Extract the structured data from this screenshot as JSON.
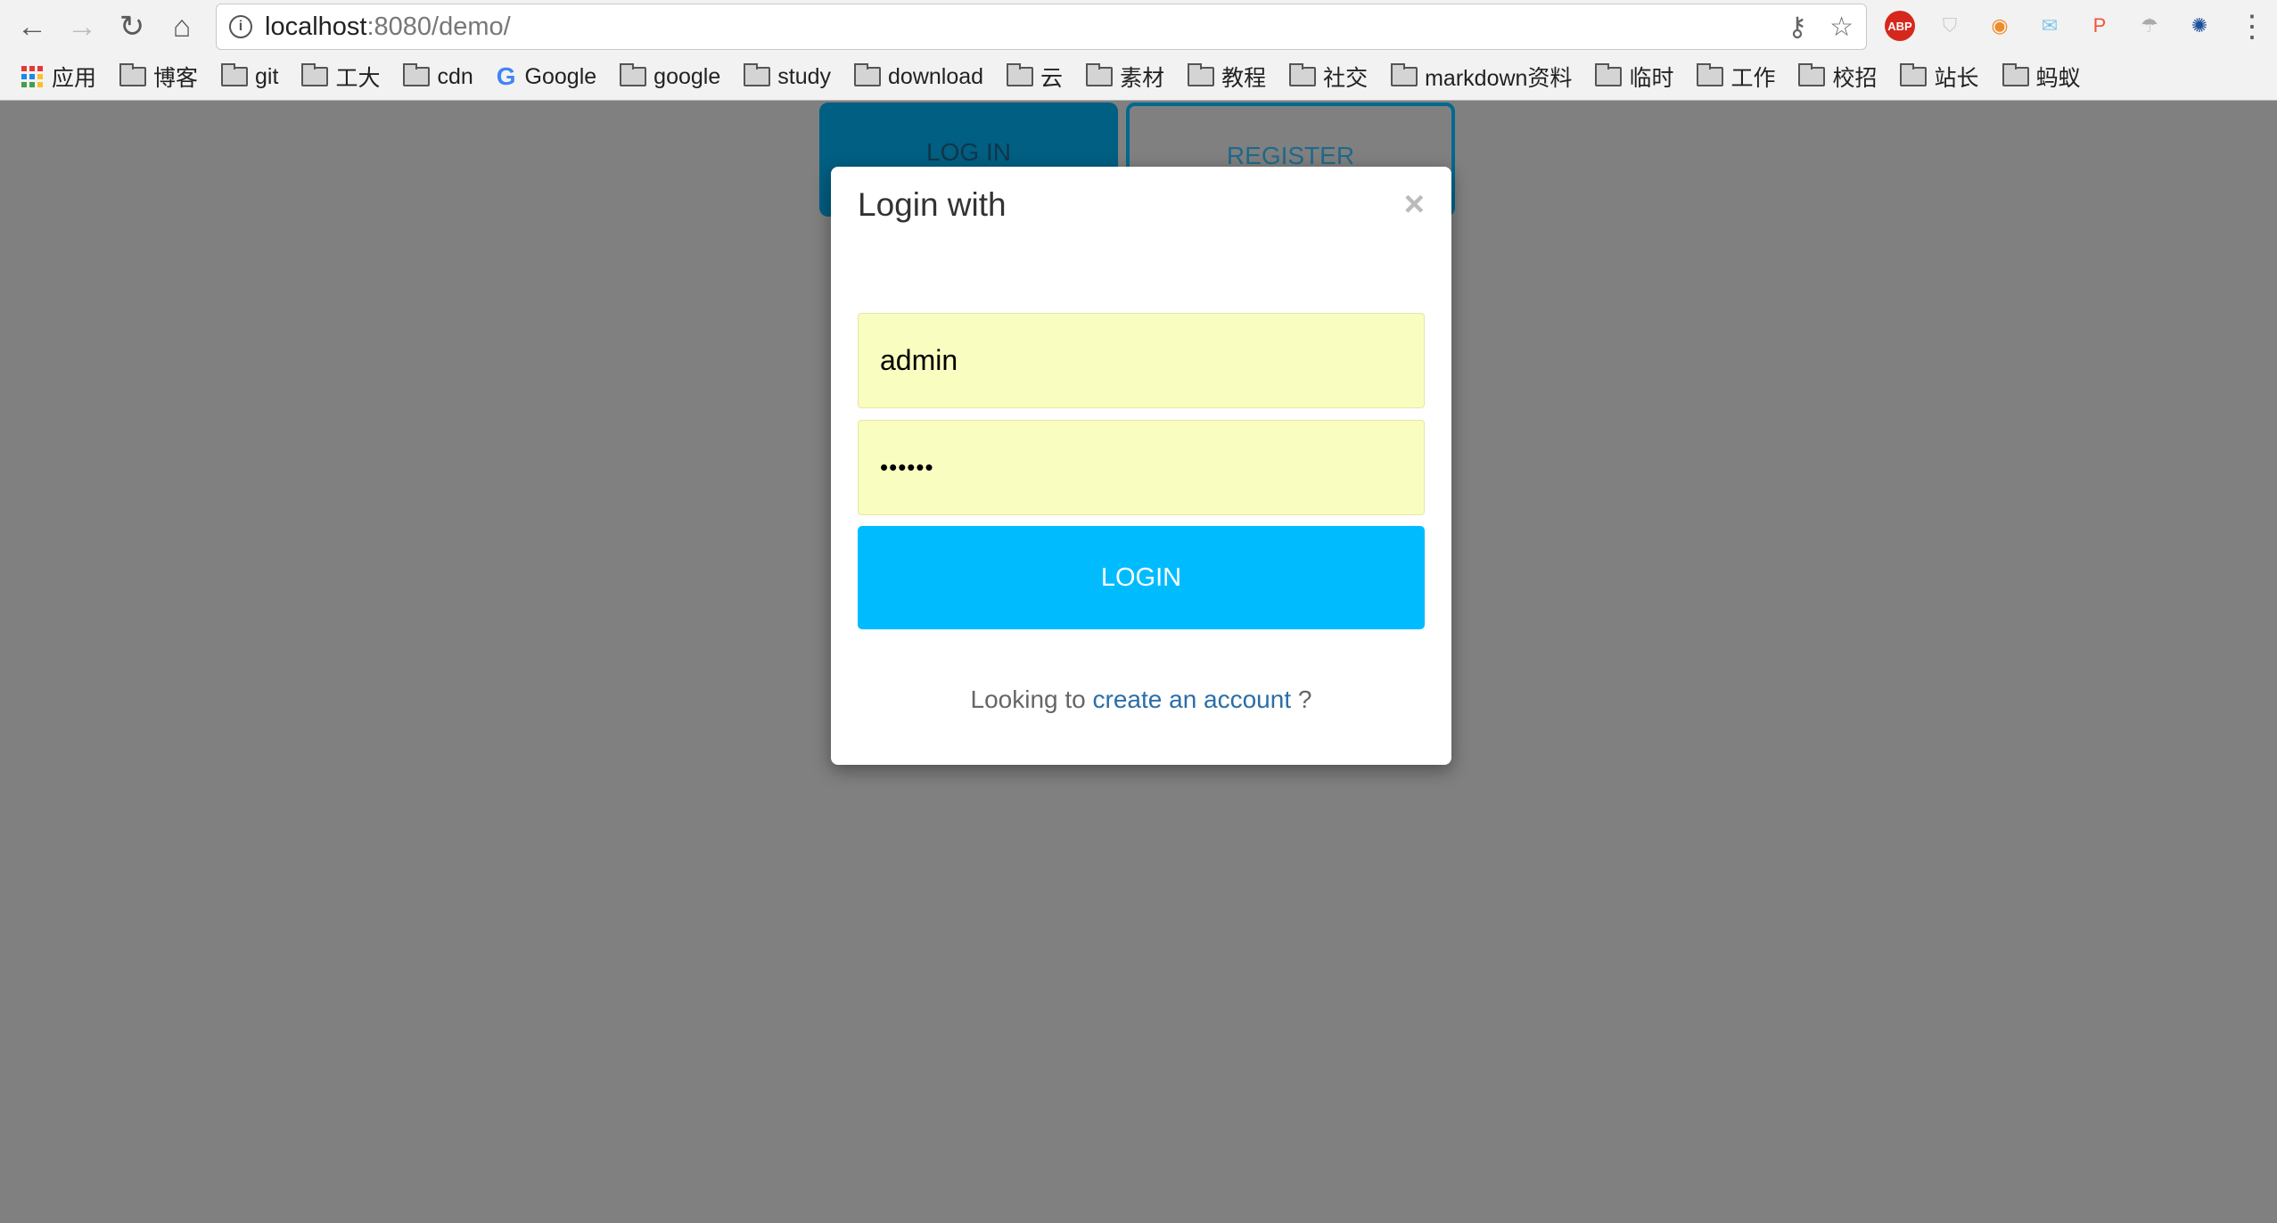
{
  "browser": {
    "url_host": "localhost",
    "url_rest": ":8080/demo/",
    "extensions": [
      {
        "name": "abp-icon",
        "label": "ABP",
        "color": "#d6271d"
      },
      {
        "name": "shield-icon",
        "label": "⛉",
        "color": "#cccccc"
      },
      {
        "name": "weibo-icon",
        "label": "◉",
        "color": "#f08c28"
      },
      {
        "name": "mail-icon",
        "label": "✉",
        "color": "#7ec6ea"
      },
      {
        "name": "p-icon",
        "label": "P",
        "color": "#f0543a"
      },
      {
        "name": "parachute-icon",
        "label": "☂",
        "color": "#aaaaaa"
      },
      {
        "name": "sun-icon",
        "label": "✺",
        "color": "#1a4f99"
      }
    ],
    "bookmarks": [
      "应用",
      "博客",
      "git",
      "工大",
      "cdn",
      "Google",
      "google",
      "study",
      "download",
      "云",
      "素材",
      "教程",
      "社交",
      "markdown资料",
      "临时",
      "工作",
      "校招",
      "站长",
      "蚂蚁"
    ]
  },
  "tabs": {
    "login": "LOG IN",
    "register": "REGISTER"
  },
  "modal": {
    "title": "Login with",
    "close": "×",
    "username": "admin",
    "password": "••••••",
    "login_button": "LOGIN",
    "footer_prefix": "Looking to ",
    "footer_link": "create an account",
    "footer_suffix": " ?"
  },
  "colors": {
    "accent": "#00bcff",
    "autofill": "#fafdc0",
    "tab_active": "#005f82",
    "link": "#2b6da8"
  }
}
